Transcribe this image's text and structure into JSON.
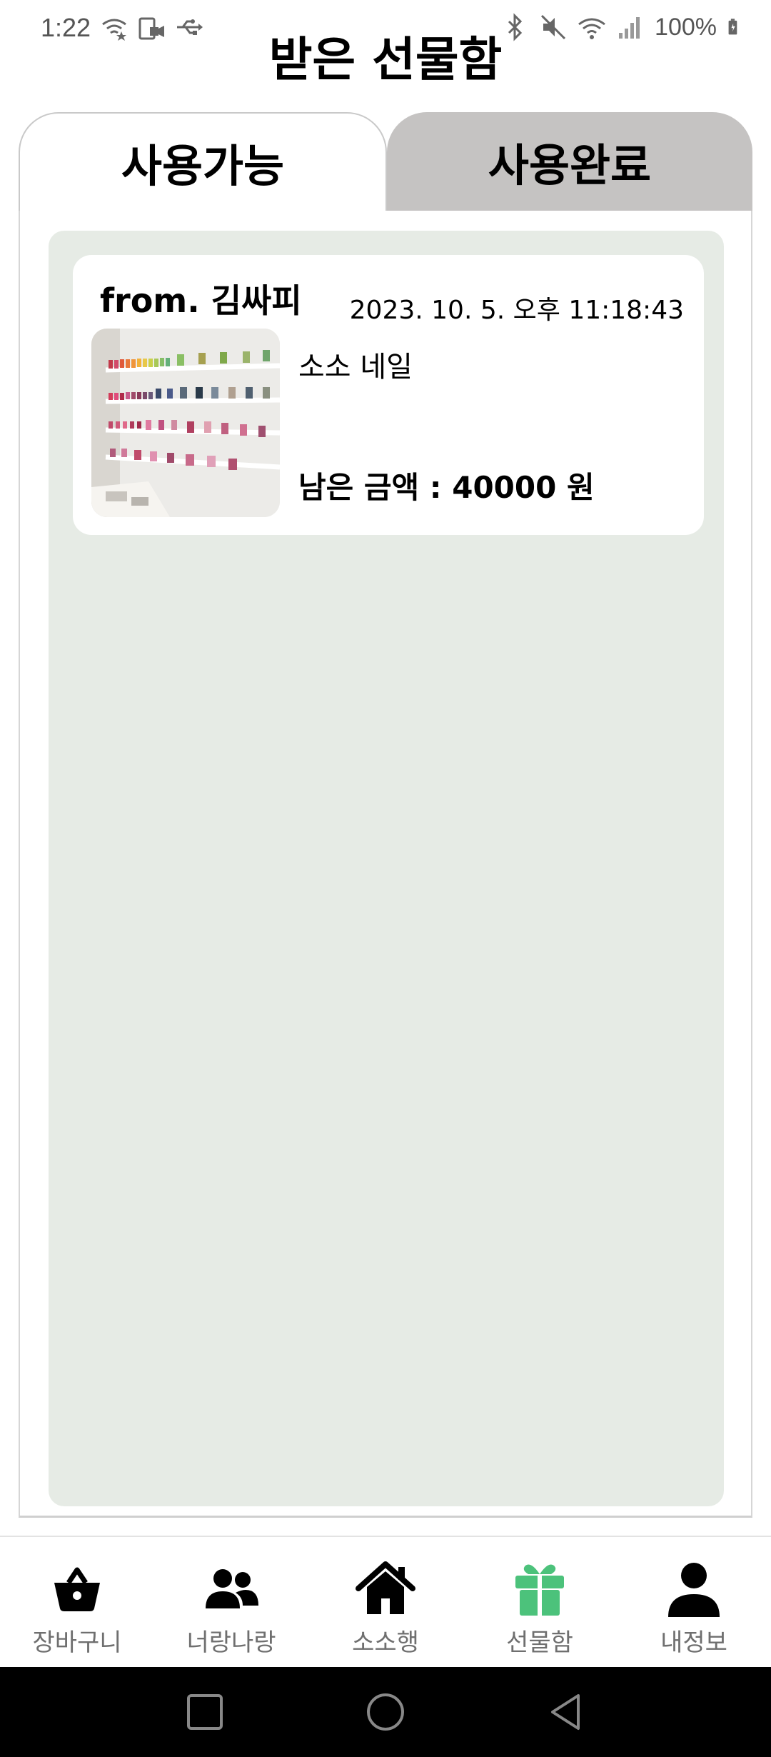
{
  "status_bar": {
    "time": "1:22",
    "battery": "100%"
  },
  "header": {
    "title": "받은 선물함"
  },
  "tabs": [
    {
      "label": "사용가능",
      "active": true
    },
    {
      "label": "사용완료",
      "active": false
    }
  ],
  "gifts": [
    {
      "from": "from. 김싸피",
      "date": "2023. 10. 5. 오후 11:18:43",
      "name": "소소 네일",
      "remaining": "남은 금액 : 40000 원",
      "image_icon": "nail-polish-shelf-image"
    }
  ],
  "bottom_nav": [
    {
      "label": "장바구니",
      "icon": "basket-icon",
      "active": false
    },
    {
      "label": "너랑나랑",
      "icon": "people-icon",
      "active": false
    },
    {
      "label": "소소행",
      "icon": "home-icon",
      "active": false
    },
    {
      "label": "선물함",
      "icon": "gift-icon",
      "active": true
    },
    {
      "label": "내정보",
      "icon": "person-icon",
      "active": false
    }
  ],
  "colors": {
    "accent": "#4cc27b",
    "inactive_tab": "#c5c3c2",
    "list_background": "#e6ebe5",
    "nav_label": "#6f6f6f"
  }
}
